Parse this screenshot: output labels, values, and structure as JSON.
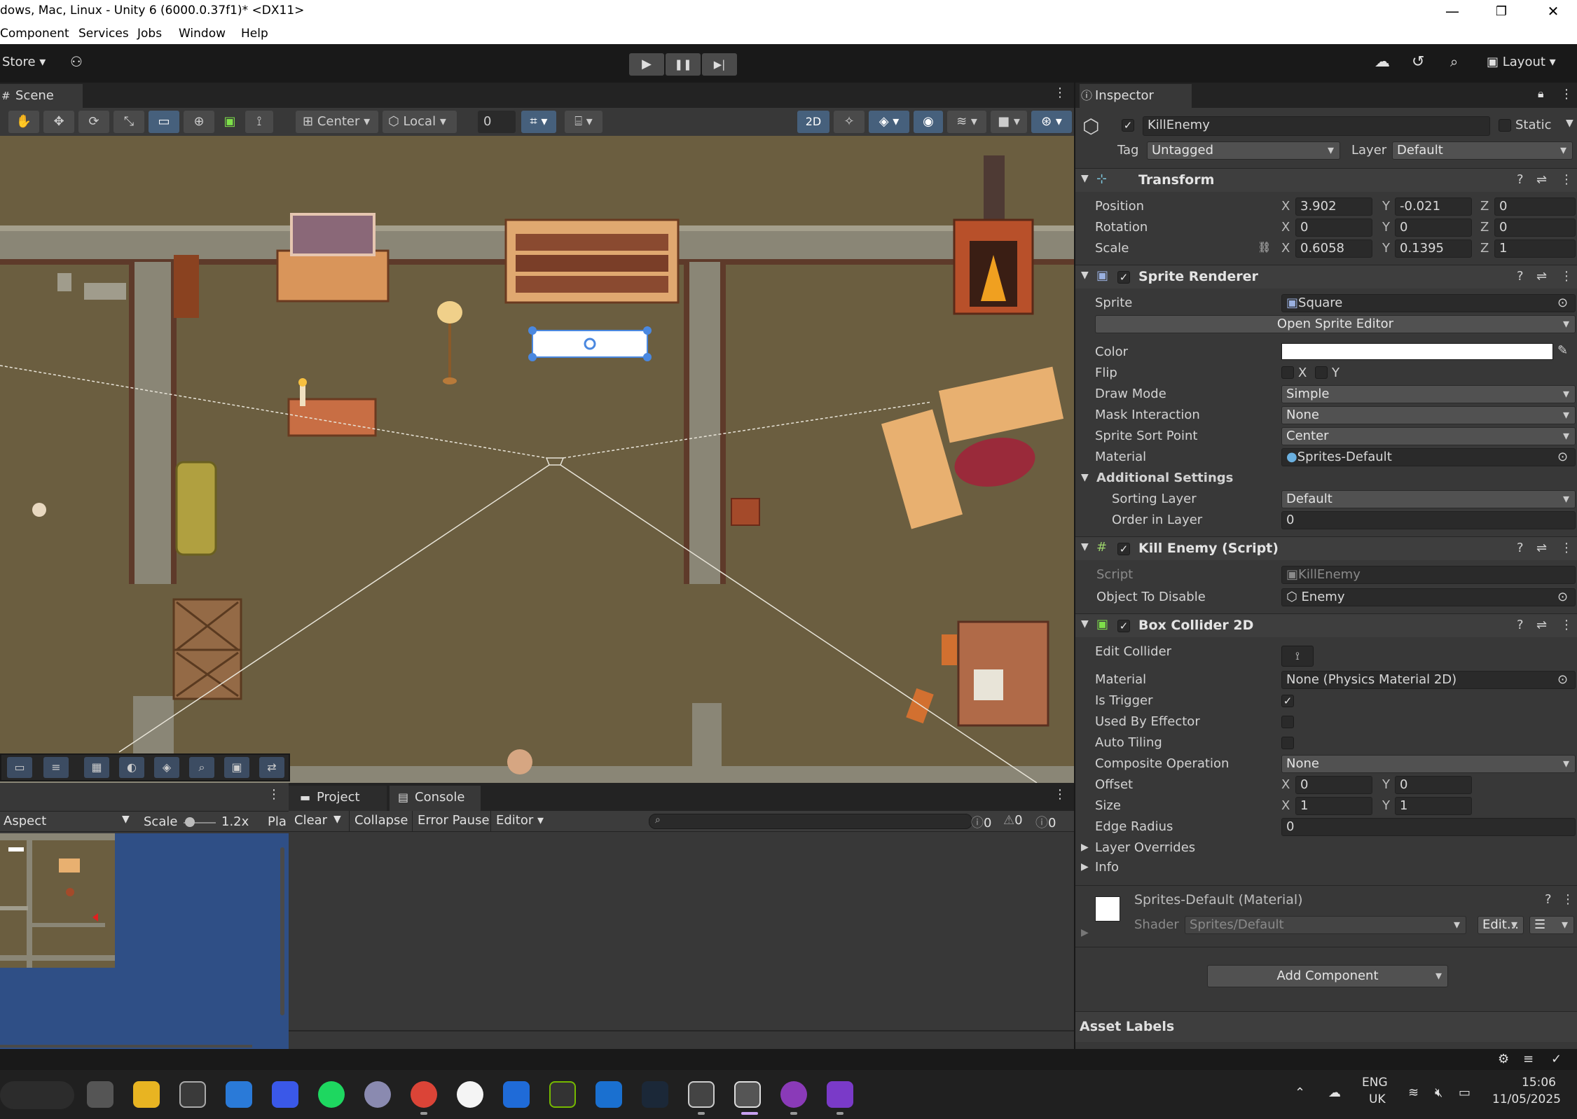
{
  "window": {
    "title": "dows, Mac, Linux - Unity 6 (6000.0.37f1)* <DX11>",
    "minimize": "—",
    "restore": "❐",
    "close": "✕"
  },
  "menu": [
    "Component",
    "Services",
    "Jobs",
    "Window",
    "Help"
  ],
  "toolbar": {
    "store": "Store",
    "layout": "Layout",
    "play": "▶",
    "pause": "❚❚",
    "step": "▶|"
  },
  "scene": {
    "tab": "Scene",
    "pivot": "Center",
    "space": "Local",
    "snap": "0",
    "mode2d": "2D"
  },
  "bottom": {
    "game_aspect": "Aspect",
    "game_scale_label": "Scale",
    "game_scale_value": "1.2x",
    "game_play": "Pla",
    "tab_project": "Project",
    "tab_console": "Console",
    "console_clear": "Clear",
    "console_collapse": "Collapse",
    "console_error_pause": "Error Pause",
    "console_editor": "Editor",
    "count_log": "0",
    "count_warn": "0",
    "count_error": "0"
  },
  "inspector": {
    "tab": "Inspector",
    "object_name": "KillEnemy",
    "static_label": "Static",
    "tag_label": "Tag",
    "tag_value": "Untagged",
    "layer_label": "Layer",
    "layer_value": "Default",
    "transform": {
      "title": "Transform",
      "position_label": "Position",
      "rotation_label": "Rotation",
      "scale_label": "Scale",
      "px": "3.902",
      "py": "-0.021",
      "pz": "0",
      "rx": "0",
      "ry": "0",
      "rz": "0",
      "sx": "0.6058",
      "sy": "0.1395",
      "sz": "1"
    },
    "sprite_renderer": {
      "title": "Sprite Renderer",
      "sprite_label": "Sprite",
      "sprite_value": "Square",
      "open_editor": "Open Sprite Editor",
      "color_label": "Color",
      "flip_label": "Flip",
      "flip_x": "X",
      "flip_y": "Y",
      "draw_mode_label": "Draw Mode",
      "draw_mode": "Simple",
      "mask_label": "Mask Interaction",
      "mask": "None",
      "sort_point_label": "Sprite Sort Point",
      "sort_point": "Center",
      "material_label": "Material",
      "material": "Sprites-Default",
      "additional": "Additional Settings",
      "sorting_layer_label": "Sorting Layer",
      "sorting_layer": "Default",
      "order_label": "Order in Layer",
      "order": "0"
    },
    "kill_enemy": {
      "title": "Kill Enemy (Script)",
      "script_label": "Script",
      "script_value": "KillEnemy",
      "disable_label": "Object To Disable",
      "disable_value": "Enemy"
    },
    "box_collider": {
      "title": "Box Collider 2D",
      "edit_label": "Edit Collider",
      "material_label": "Material",
      "material": "None (Physics Material 2D)",
      "trigger_label": "Is Trigger",
      "effector_label": "Used By Effector",
      "tiling_label": "Auto Tiling",
      "composite_label": "Composite Operation",
      "composite": "None",
      "offset_label": "Offset",
      "ox": "0",
      "oy": "0",
      "size_label": "Size",
      "sizex": "1",
      "sizey": "1",
      "edge_label": "Edge Radius",
      "edge": "0",
      "overrides": "Layer Overrides",
      "info": "Info"
    },
    "material": {
      "title": "Sprites-Default (Material)",
      "shader_label": "Shader",
      "shader": "Sprites/Default",
      "edit": "Edit..."
    },
    "add_component": "Add Component",
    "asset_labels": "Asset Labels"
  },
  "taskbar": {
    "lang1": "ENG",
    "lang2": "UK",
    "time": "15:06",
    "date": "11/05/2025"
  },
  "colors": {
    "accent": "#3c5a82",
    "selection_handle": "#4a88e0",
    "scene_floor": "#6b5e40",
    "wall": "#8a8676"
  }
}
